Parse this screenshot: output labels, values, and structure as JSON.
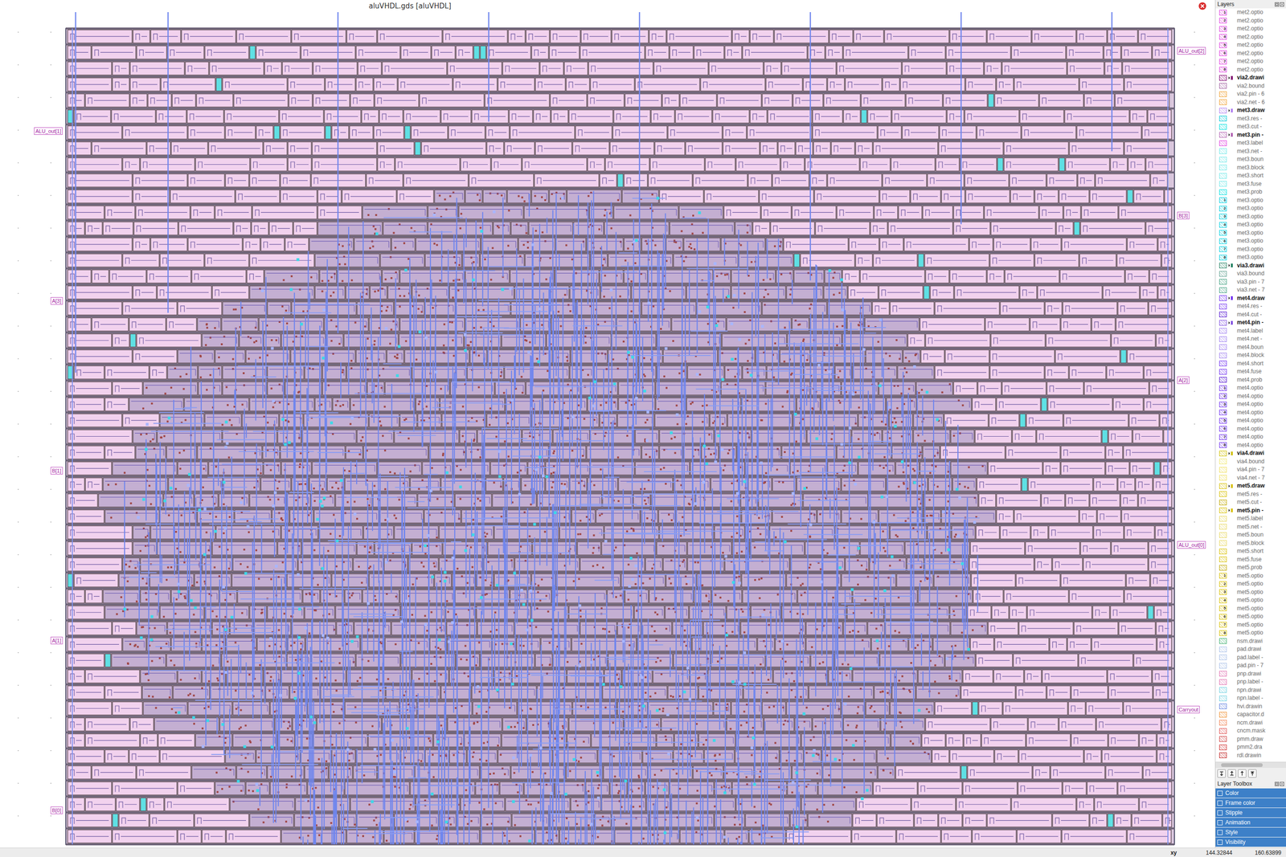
{
  "window": {
    "title": "aluVHDL.gds [aluVHDL]"
  },
  "canvas": {
    "pins_left": [
      "ALU_out[1]",
      "A[3]",
      "B[1]",
      "A[1]",
      "B[0]"
    ],
    "pins_right": [
      "ALU_out[2]",
      "B[3]",
      "A[2]",
      "ALU_out[0]",
      "Carryout"
    ]
  },
  "layers_panel": {
    "title": "Layers",
    "items": [
      {
        "name": "met2.optio",
        "bold": false,
        "color": "#e040e0",
        "tag": "1"
      },
      {
        "name": "met2.optio",
        "bold": false,
        "color": "#e040e0",
        "tag": "2"
      },
      {
        "name": "met2.optio",
        "bold": false,
        "color": "#e040e0",
        "tag": "3"
      },
      {
        "name": "met2.optio",
        "bold": false,
        "color": "#e040e0",
        "tag": "4"
      },
      {
        "name": "met2.optio",
        "bold": false,
        "color": "#e040e0",
        "tag": "5"
      },
      {
        "name": "met2.optio",
        "bold": false,
        "color": "#e040e0",
        "tag": "6"
      },
      {
        "name": "met2.optio",
        "bold": false,
        "color": "#e040e0",
        "tag": "7"
      },
      {
        "name": "met2.optio",
        "bold": false,
        "color": "#e040e0",
        "tag": "8"
      },
      {
        "name": "via2.drawi",
        "bold": true,
        "color": "#800070",
        "tag": ""
      },
      {
        "name": "via2.bound",
        "bold": false,
        "color": "#a060a0",
        "tag": ""
      },
      {
        "name": "via2.pin - 6",
        "bold": false,
        "color": "#f0a030",
        "tag": ""
      },
      {
        "name": "via2.net - 6",
        "bold": false,
        "color": "#f0a030",
        "tag": ""
      },
      {
        "name": "met3.draw",
        "bold": true,
        "color": "#b080f0",
        "tag": ""
      },
      {
        "name": "met3.res -",
        "bold": false,
        "color": "#00c8d8",
        "tag": ""
      },
      {
        "name": "met3.cut -",
        "bold": false,
        "color": "#00e0e0",
        "tag": ""
      },
      {
        "name": "met3.pin -",
        "bold": true,
        "color": "#b060b0",
        "tag": ""
      },
      {
        "name": "met3.label",
        "bold": false,
        "color": "#e040e0",
        "tag": ""
      },
      {
        "name": "met3.net -",
        "bold": false,
        "color": "#70e8e8",
        "tag": ""
      },
      {
        "name": "met3.boun",
        "bold": false,
        "color": "#70e8e8",
        "tag": ""
      },
      {
        "name": "met3.block",
        "bold": false,
        "color": "#70e8e8",
        "tag": ""
      },
      {
        "name": "met3.short",
        "bold": false,
        "color": "#70e8e8",
        "tag": ""
      },
      {
        "name": "met3.fuse",
        "bold": false,
        "color": "#70e8e8",
        "tag": ""
      },
      {
        "name": "met3.prob",
        "bold": false,
        "color": "#00e0e0",
        "tag": ""
      },
      {
        "name": "met3.optio",
        "bold": false,
        "color": "#00d0e0",
        "tag": "1"
      },
      {
        "name": "met3.optio",
        "bold": false,
        "color": "#00d0e0",
        "tag": "2"
      },
      {
        "name": "met3.optio",
        "bold": false,
        "color": "#00d0e0",
        "tag": "3"
      },
      {
        "name": "met3.optio",
        "bold": false,
        "color": "#00d0e0",
        "tag": "4"
      },
      {
        "name": "met3.optio",
        "bold": false,
        "color": "#00d0e0",
        "tag": "5"
      },
      {
        "name": "met3.optio",
        "bold": false,
        "color": "#00d0e0",
        "tag": "6"
      },
      {
        "name": "met3.optio",
        "bold": false,
        "color": "#00d0e0",
        "tag": "7"
      },
      {
        "name": "met3.optio",
        "bold": false,
        "color": "#00d0e0",
        "tag": "8"
      },
      {
        "name": "via3.drawi",
        "bold": true,
        "color": "#208060",
        "tag": ""
      },
      {
        "name": "via3.bound",
        "bold": false,
        "color": "#60a090",
        "tag": ""
      },
      {
        "name": "via3.pin - 7",
        "bold": false,
        "color": "#40a080",
        "tag": ""
      },
      {
        "name": "via3.net - 7",
        "bold": false,
        "color": "#40a080",
        "tag": ""
      },
      {
        "name": "met4.draw",
        "bold": true,
        "color": "#7030f0",
        "tag": ""
      },
      {
        "name": "met4.res -",
        "bold": false,
        "color": "#7030f0",
        "tag": ""
      },
      {
        "name": "met4.cut -",
        "bold": false,
        "color": "#5010d0",
        "tag": ""
      },
      {
        "name": "met4.pin -",
        "bold": true,
        "color": "#8050e0",
        "tag": ""
      },
      {
        "name": "met4.label",
        "bold": false,
        "color": "#a080f0",
        "tag": ""
      },
      {
        "name": "met4.net -",
        "bold": false,
        "color": "#a080f0",
        "tag": ""
      },
      {
        "name": "met4.boun",
        "bold": false,
        "color": "#a080f0",
        "tag": ""
      },
      {
        "name": "met4.block",
        "bold": false,
        "color": "#a080f0",
        "tag": ""
      },
      {
        "name": "met4.short",
        "bold": false,
        "color": "#7030f0",
        "tag": ""
      },
      {
        "name": "met4.fuse",
        "bold": false,
        "color": "#7030f0",
        "tag": ""
      },
      {
        "name": "met4.prob",
        "bold": false,
        "color": "#5010d0",
        "tag": ""
      },
      {
        "name": "met4.optio",
        "bold": false,
        "color": "#7030f0",
        "tag": "1"
      },
      {
        "name": "met4.optio",
        "bold": false,
        "color": "#7030f0",
        "tag": "2"
      },
      {
        "name": "met4.optio",
        "bold": false,
        "color": "#7030f0",
        "tag": "3"
      },
      {
        "name": "met4.optio",
        "bold": false,
        "color": "#7030f0",
        "tag": "4"
      },
      {
        "name": "met4.optio",
        "bold": false,
        "color": "#7030f0",
        "tag": "5"
      },
      {
        "name": "met4.optio",
        "bold": false,
        "color": "#7030f0",
        "tag": "6"
      },
      {
        "name": "met4.optio",
        "bold": false,
        "color": "#7030f0",
        "tag": "7"
      },
      {
        "name": "met4.optio",
        "bold": false,
        "color": "#7030f0",
        "tag": "8"
      },
      {
        "name": "via4.drawi",
        "bold": true,
        "color": "#d0c000",
        "tag": ""
      },
      {
        "name": "via4.bound",
        "bold": false,
        "color": "#f0e870",
        "tag": ""
      },
      {
        "name": "via4.pin - 7",
        "bold": false,
        "color": "#f0e060",
        "tag": ""
      },
      {
        "name": "via4.net - 7",
        "bold": false,
        "color": "#f0e060",
        "tag": ""
      },
      {
        "name": "met5.draw",
        "bold": true,
        "color": "#d8c000",
        "tag": ""
      },
      {
        "name": "met5.res -",
        "bold": false,
        "color": "#d8c000",
        "tag": ""
      },
      {
        "name": "met5.cut -",
        "bold": false,
        "color": "#c0a800",
        "tag": ""
      },
      {
        "name": "met5.pin -",
        "bold": true,
        "color": "#d8c000",
        "tag": ""
      },
      {
        "name": "met5.label",
        "bold": false,
        "color": "#e8d860",
        "tag": ""
      },
      {
        "name": "met5.net -",
        "bold": false,
        "color": "#e8d860",
        "tag": ""
      },
      {
        "name": "met5.boun",
        "bold": false,
        "color": "#e8d860",
        "tag": ""
      },
      {
        "name": "met5.block",
        "bold": false,
        "color": "#e8d860",
        "tag": ""
      },
      {
        "name": "met5.short",
        "bold": false,
        "color": "#d8c000",
        "tag": ""
      },
      {
        "name": "met5.fuse",
        "bold": false,
        "color": "#d8c000",
        "tag": ""
      },
      {
        "name": "met5.prob",
        "bold": false,
        "color": "#c0a800",
        "tag": ""
      },
      {
        "name": "met5.optio",
        "bold": false,
        "color": "#d8c000",
        "tag": "1"
      },
      {
        "name": "met5.optio",
        "bold": false,
        "color": "#d8c000",
        "tag": "2"
      },
      {
        "name": "met5.optio",
        "bold": false,
        "color": "#d8c000",
        "tag": "3"
      },
      {
        "name": "met5.optio",
        "bold": false,
        "color": "#d8c000",
        "tag": "4"
      },
      {
        "name": "met5.optio",
        "bold": false,
        "color": "#d8c000",
        "tag": "5"
      },
      {
        "name": "met5.optio",
        "bold": false,
        "color": "#d8c000",
        "tag": "6"
      },
      {
        "name": "met5.optio",
        "bold": false,
        "color": "#d8c000",
        "tag": "7"
      },
      {
        "name": "met5.optio",
        "bold": false,
        "color": "#d8c000",
        "tag": "8"
      },
      {
        "name": "nsm.drawi",
        "bold": false,
        "color": "#40b070",
        "tag": ""
      },
      {
        "name": "pad.drawi",
        "bold": false,
        "color": "#a8c0e8",
        "tag": ""
      },
      {
        "name": "pad.label -",
        "bold": false,
        "color": "#a8c0e8",
        "tag": ""
      },
      {
        "name": "pad.pin - 7",
        "bold": false,
        "color": "#a8c0e8",
        "tag": ""
      },
      {
        "name": "pnp.drawi",
        "bold": false,
        "color": "#e070b0",
        "tag": ""
      },
      {
        "name": "pnp.label -",
        "bold": false,
        "color": "#e070b0",
        "tag": ""
      },
      {
        "name": "npn.drawi",
        "bold": false,
        "color": "#70d0e0",
        "tag": ""
      },
      {
        "name": "npn.label -",
        "bold": false,
        "color": "#70d0e0",
        "tag": ""
      },
      {
        "name": "hvi.drawin",
        "bold": false,
        "color": "#6080e0",
        "tag": ""
      },
      {
        "name": "capacitor.d",
        "bold": false,
        "color": "#f09030",
        "tag": ""
      },
      {
        "name": "ncm.drawi",
        "bold": false,
        "color": "#f08050",
        "tag": ""
      },
      {
        "name": "cncm.mask",
        "bold": false,
        "color": "#e05050",
        "tag": ""
      },
      {
        "name": "pmm.draw",
        "bold": false,
        "color": "#d04040",
        "tag": ""
      },
      {
        "name": "pmm2.dra",
        "bold": false,
        "color": "#d03030",
        "tag": ""
      },
      {
        "name": "rdl.drawin",
        "bold": false,
        "color": "#c02020",
        "tag": ""
      }
    ]
  },
  "toolbox": {
    "title": "Layer Toolbox",
    "items": [
      "Color",
      "Frame color",
      "Stipple",
      "Animation",
      "Style",
      "Visibility"
    ]
  },
  "status_bar": {
    "label": "xy",
    "x": "144.32844",
    "y": "160.63899"
  }
}
